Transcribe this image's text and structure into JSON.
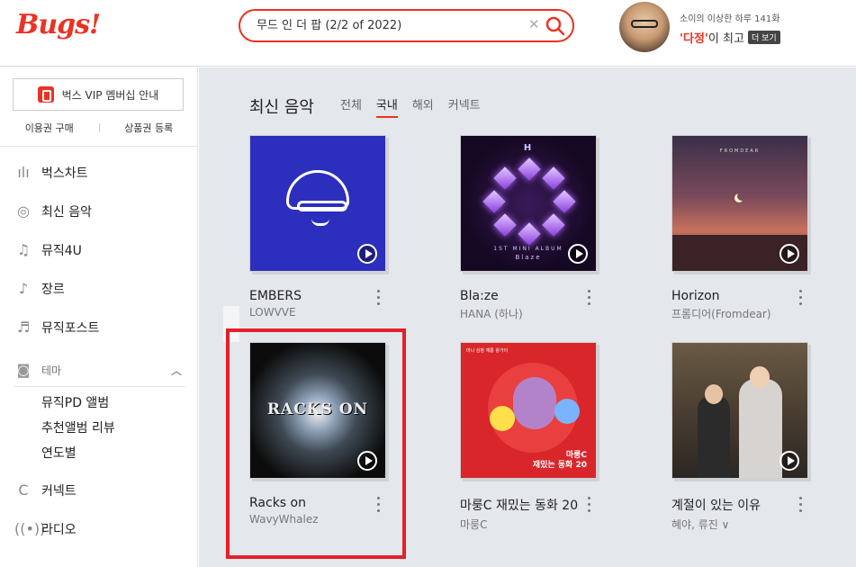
{
  "header": {
    "logo": "Bugs!",
    "search_value": "무드 인 더 팝 (2/2 of 2022)",
    "clear_icon": "close-icon",
    "search_icon": "search-icon",
    "user_subtitle": "소이의 이상한 하루 141화",
    "user_name_highlight": "'다정'",
    "user_name_rest": "이 최고",
    "more_badge": "더 보기"
  },
  "sidebar": {
    "vip_label": "벅스 VIP 멤버십 안내",
    "sub_links": [
      "이용권 구매",
      "상품권 등록"
    ],
    "nav": [
      {
        "label": "벅스차트",
        "icon": "chart-icon"
      },
      {
        "label": "최신 음악",
        "icon": "new-music-icon"
      },
      {
        "label": "뮤직4U",
        "icon": "music-note-icon"
      },
      {
        "label": "장르",
        "icon": "guitar-icon"
      },
      {
        "label": "뮤직포스트",
        "icon": "post-icon"
      }
    ],
    "theme_label": "테마",
    "theme_items": [
      "뮤직PD 앨범",
      "추천앨범 리뷰",
      "연도별"
    ],
    "nav_bottom": [
      {
        "label": "커넥트",
        "icon": "connect-icon"
      },
      {
        "label": "라디오",
        "icon": "radio-icon"
      }
    ]
  },
  "main": {
    "title": "최신 음악",
    "tabs": [
      "전체",
      "국내",
      "해외",
      "커넥트"
    ],
    "active_tab": "국내",
    "albums": [
      {
        "title": "EMBERS",
        "artist": "LOWVVE"
      },
      {
        "title": "Bla:ze",
        "artist": "HANA (하나)",
        "cover_top": "H",
        "cover_sub": "1ST MINI ALBUM",
        "cover_name": "Blaze"
      },
      {
        "title": "Horizon",
        "artist": "프롬디어(Fromdear)",
        "cover_brand": "FROMDEAR"
      },
      {
        "title": "Racks on",
        "artist": "WavyWhalez",
        "cover_text": "RACKS ON"
      },
      {
        "title": "마룽C 재밌는 동화 20",
        "artist": "마룽C",
        "cover_corner": "마니 심청\n재롱 왕가이",
        "cover_label": "마룽C\n재밌는 동화 20"
      },
      {
        "title": "계절이 있는 이유",
        "artist": "혜야, 류진 ∨"
      }
    ]
  },
  "colors": {
    "accent": "#ea3323",
    "highlight_box": "#e3202b",
    "main_bg": "#e4e7eb"
  }
}
